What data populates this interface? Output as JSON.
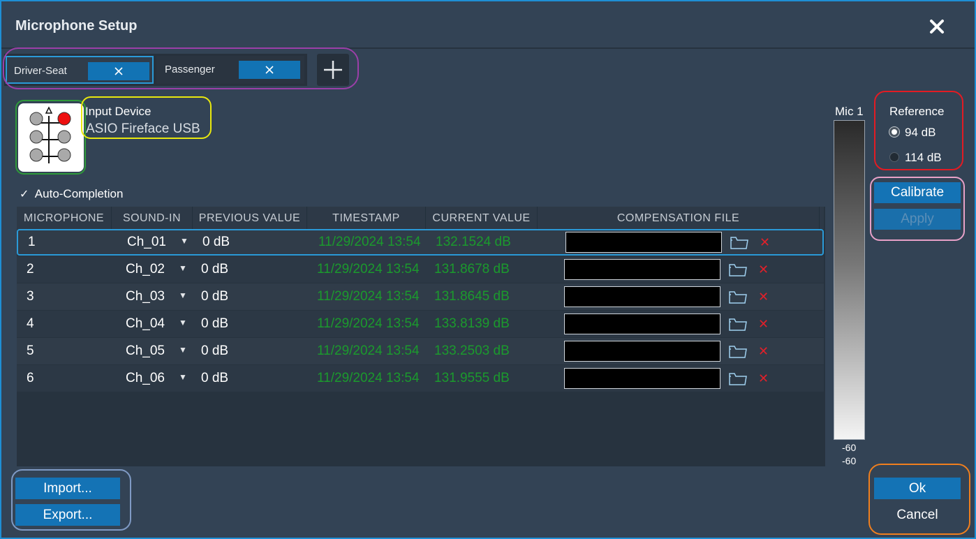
{
  "window": {
    "title": "Microphone Setup"
  },
  "tabs": [
    {
      "label": "Driver-Seat",
      "active": true
    },
    {
      "label": "Passenger",
      "active": false
    }
  ],
  "device": {
    "label": "Input Device",
    "name": "ASIO Fireface USB"
  },
  "auto_completion": {
    "label": "Auto-Completion",
    "checked": true,
    "check_glyph": "✓"
  },
  "table": {
    "columns": [
      "MICROPHONE",
      "SOUND-IN",
      "PREVIOUS VALUE",
      "TIMESTAMP",
      "CURRENT VALUE",
      "COMPENSATION FILE"
    ],
    "rows": [
      {
        "mic": "1",
        "sound_in": "Ch_01",
        "previous": "0 dB",
        "timestamp": "11/29/2024 13:54",
        "current": "132.1524 dB"
      },
      {
        "mic": "2",
        "sound_in": "Ch_02",
        "previous": "0 dB",
        "timestamp": "11/29/2024 13:54",
        "current": "131.8678 dB"
      },
      {
        "mic": "3",
        "sound_in": "Ch_03",
        "previous": "0 dB",
        "timestamp": "11/29/2024 13:54",
        "current": "131.8645 dB"
      },
      {
        "mic": "4",
        "sound_in": "Ch_04",
        "previous": "0 dB",
        "timestamp": "11/29/2024 13:54",
        "current": "133.8139 dB"
      },
      {
        "mic": "5",
        "sound_in": "Ch_05",
        "previous": "0 dB",
        "timestamp": "11/29/2024 13:54",
        "current": "133.2503 dB"
      },
      {
        "mic": "6",
        "sound_in": "Ch_06",
        "previous": "0 dB",
        "timestamp": "11/29/2024 13:54",
        "current": "131.9555 dB"
      }
    ],
    "selected_row": 1,
    "dropdown_glyph": "▼",
    "remove_glyph": "✕"
  },
  "meter": {
    "label": "Mic 1",
    "min_top": "-60",
    "min_bottom": "-60"
  },
  "reference": {
    "title": "Reference",
    "options": [
      {
        "label": "94 dB",
        "selected": true
      },
      {
        "label": "114 dB",
        "selected": false
      }
    ]
  },
  "buttons": {
    "calibrate": "Calibrate",
    "apply": "Apply",
    "import": "Import...",
    "export": "Export...",
    "ok": "Ok",
    "cancel": "Cancel"
  },
  "colors": {
    "accent": "#1473b5",
    "window_border": "#1e8fd4",
    "measured_value": "#1b9a2d",
    "remove": "#e0202a",
    "outline_tabs": "#9b3fa8",
    "outline_device_icon": "#2f9a3a",
    "outline_device_name": "#e9e80e",
    "outline_reference": "#e31b23",
    "outline_calibrate": "#e8a1c8",
    "outline_import_export": "#7f9ac4",
    "outline_ok_cancel": "#f07f1e"
  },
  "icons": {
    "close": "close-icon",
    "add_tab": "plus-icon",
    "device": "microphone-array-icon",
    "folder": "folder-icon",
    "remove": "remove-icon"
  }
}
